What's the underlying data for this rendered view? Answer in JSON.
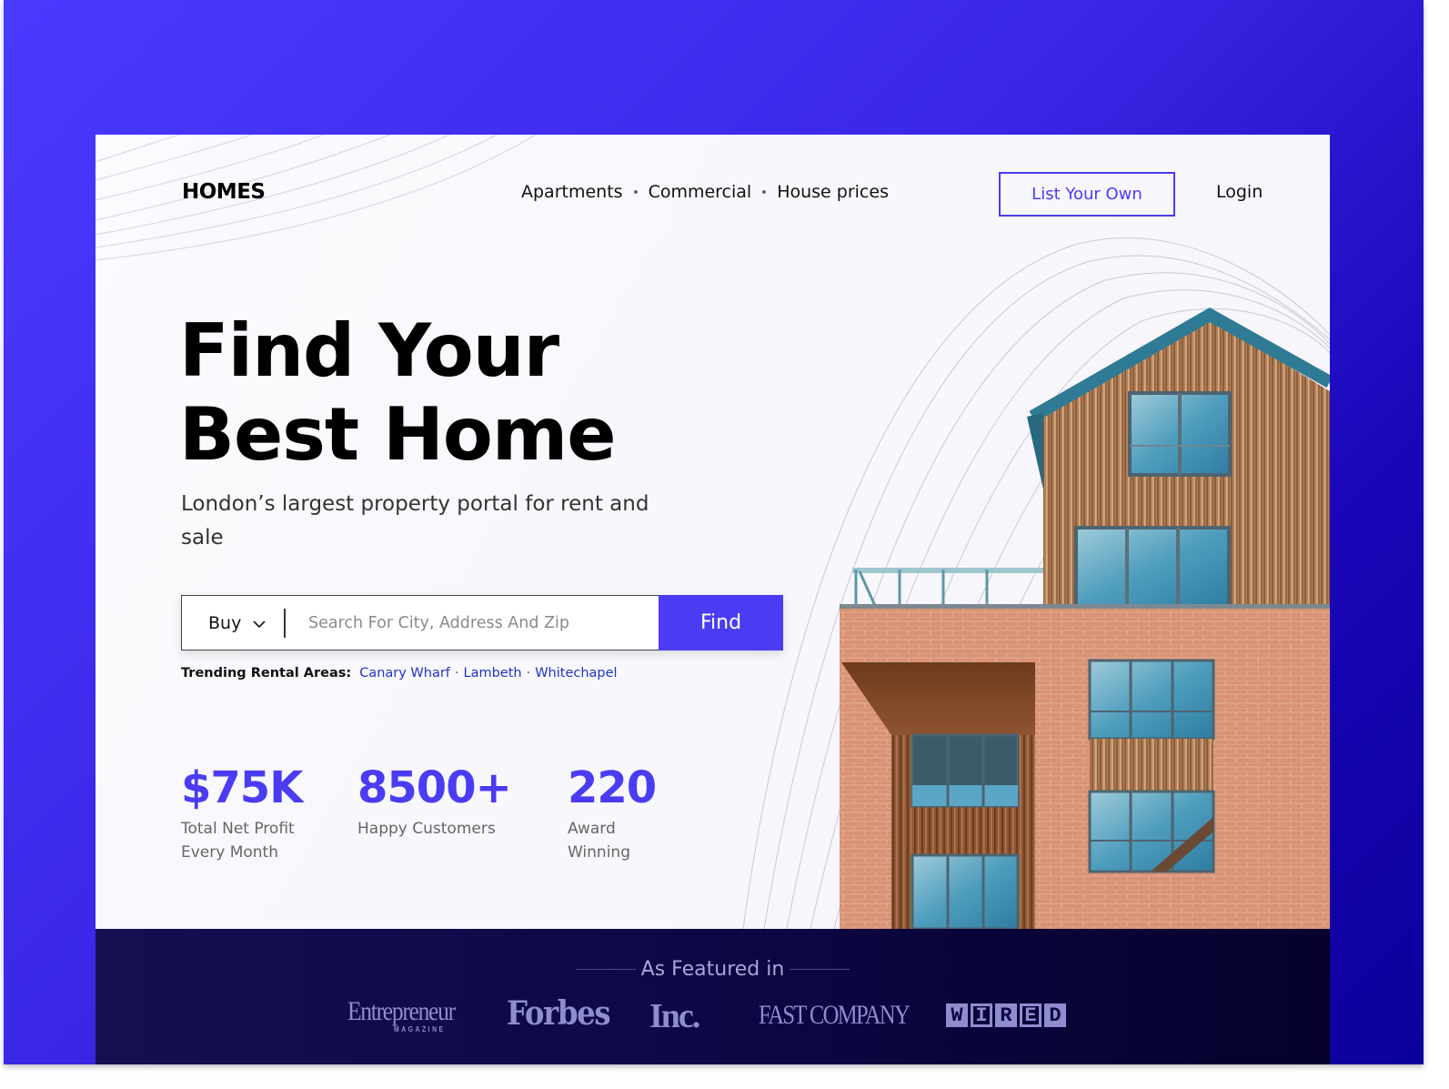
{
  "colors": {
    "accent": "#4b3cf4",
    "link": "#1f33c9",
    "footer_bg": "#0c0845",
    "brand_logo": "#8f8cd0"
  },
  "header": {
    "logo": "HOMES",
    "nav": [
      {
        "label": "Apartments"
      },
      {
        "label": "Commercial"
      },
      {
        "label": "House prices"
      }
    ],
    "list_button": "List Your Own",
    "login": "Login"
  },
  "hero": {
    "title_line1": "Find Your",
    "title_line2": "Best Home",
    "subtitle": "London’s largest property portal for rent and sale",
    "image_alt": "Modern brick and timber-clad apartment building"
  },
  "search": {
    "mode": "Buy",
    "mode_icon": "chevron-down-icon",
    "placeholder": "Search For City, Address And Zip",
    "value": "",
    "button": "Find"
  },
  "trending": {
    "label": "Trending Rental Areas:",
    "areas": [
      "Canary Wharf",
      "Lambeth",
      "Whitechapel"
    ]
  },
  "stats": [
    {
      "value": "$75K",
      "caption_line1": "Total Net Profit",
      "caption_line2": "Every Month"
    },
    {
      "value": "8500+",
      "caption_line1": "Happy Customers",
      "caption_line2": ""
    },
    {
      "value": "220",
      "caption_line1": "Award Winning",
      "caption_line2": ""
    }
  ],
  "featured": {
    "title": "As Featured in",
    "brands": {
      "entrepreneur": "Entrepreneur",
      "entrepreneur_sub": "MAGAZINE",
      "forbes": "Forbes",
      "inc": "Inc.",
      "fastcompany": "FAST COMPANY",
      "wired": [
        "W",
        "I",
        "R",
        "E",
        "D"
      ]
    }
  }
}
